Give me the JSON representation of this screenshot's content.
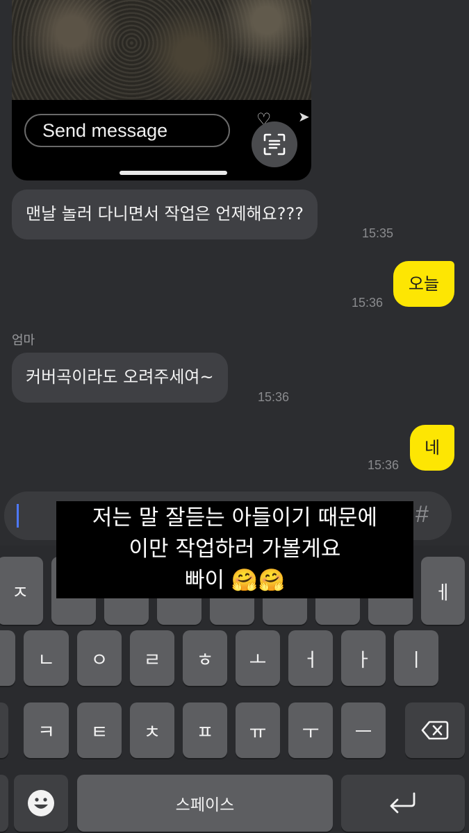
{
  "story": {
    "send_placeholder": "Send message"
  },
  "messages": [
    {
      "text": "맨날 놀러 다니면서 작업은 언제해요???",
      "time": "15:35",
      "side": "in"
    },
    {
      "text": "오늘",
      "time": "15:36",
      "side": "out"
    },
    {
      "sender": "엄마",
      "text": "커버곡이라도 오려주세여~",
      "time": "15:36",
      "side": "in"
    },
    {
      "text": "네",
      "time": "15:36",
      "side": "out"
    }
  ],
  "input": {
    "hash": "#"
  },
  "caption": {
    "line1": "저는 말 잘듣는 아들이기 때문에",
    "line2": "이만 작업하러 가볼게요",
    "line3": "빠이 🤗🤗"
  },
  "keyboard": {
    "row1": [
      "ㅈ",
      "",
      "",
      "",
      "",
      "",
      "",
      "",
      "ㅔ"
    ],
    "row2": [
      "ㄴ",
      "ㅇ",
      "ㄹ",
      "ㅎ",
      "ㅗ",
      "ㅓ",
      "ㅏ",
      "ㅣ"
    ],
    "row3": [
      "ㅋ",
      "ㅌ",
      "ㅊ",
      "ㅍ",
      "ㅠ",
      "ㅜ",
      "ㅡ"
    ],
    "space": "스페이스"
  },
  "colors": {
    "background": "#2c2d30",
    "incoming_bubble": "#3f4044",
    "outgoing_bubble": "#fde603",
    "caret": "#4d79ff"
  }
}
